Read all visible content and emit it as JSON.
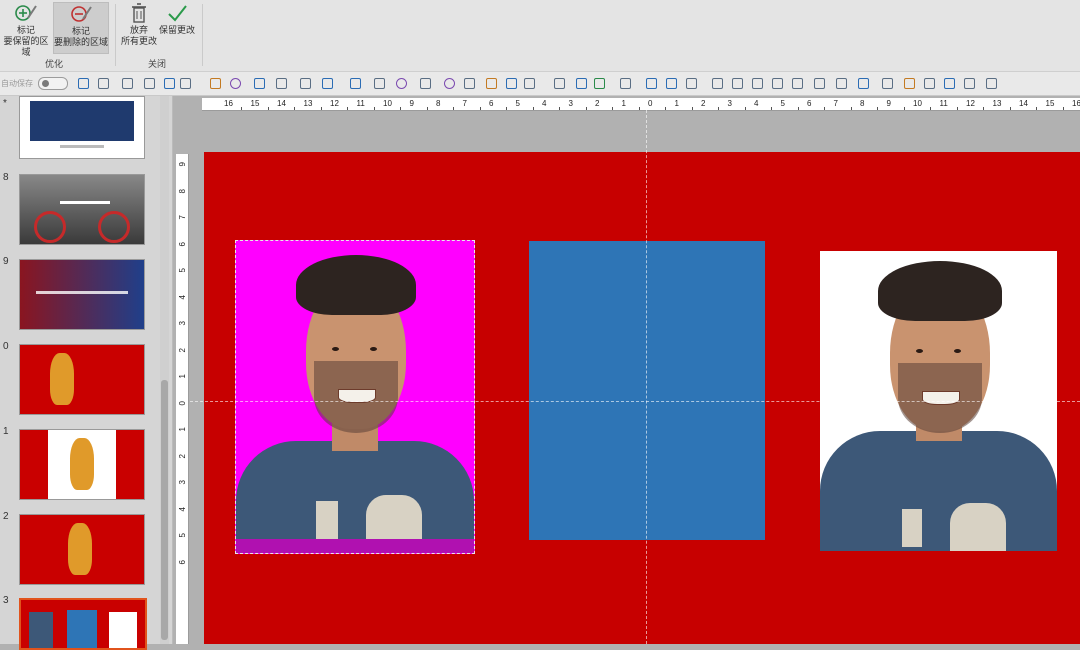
{
  "ribbon": {
    "buttons": [
      {
        "line1": "标记",
        "line2": "要保留的区域"
      },
      {
        "line1": "标记",
        "line2": "要删除的区域"
      },
      {
        "line1": "放弃",
        "line2": "所有更改"
      },
      {
        "line1": "保留更改",
        "line2": ""
      }
    ],
    "groups": {
      "optimize": "优化",
      "close": "关闭"
    },
    "icons": [
      "plus-pencil-icon",
      "minus-pencil-icon",
      "trash-icon",
      "checkmark-icon"
    ]
  },
  "toolbar": {
    "autosave_label": "自动保存"
  },
  "thumbnails": {
    "numbers": [
      "8",
      "9",
      "0",
      "1",
      "2",
      "3"
    ],
    "top_marker": "*",
    "selected_index": 13
  },
  "rulers": {
    "horizontal": [
      "16",
      "15",
      "14",
      "13",
      "12",
      "11",
      "10",
      "9",
      "8",
      "7",
      "6",
      "5",
      "4",
      "3",
      "2",
      "1",
      "0",
      "1",
      "2",
      "3",
      "4",
      "5",
      "6",
      "7",
      "8",
      "9",
      "10",
      "11",
      "12",
      "13",
      "14",
      "15",
      "16"
    ],
    "vertical": [
      "9",
      "8",
      "7",
      "6",
      "5",
      "4",
      "3",
      "2",
      "1",
      "0",
      "1",
      "2",
      "3",
      "4",
      "5",
      "6"
    ]
  },
  "colors": {
    "slide": "#c70000",
    "magenta": "#ff00ff",
    "blue": "#2e75b6",
    "white": "#ffffff",
    "ribbon": "#e4e4e4"
  }
}
